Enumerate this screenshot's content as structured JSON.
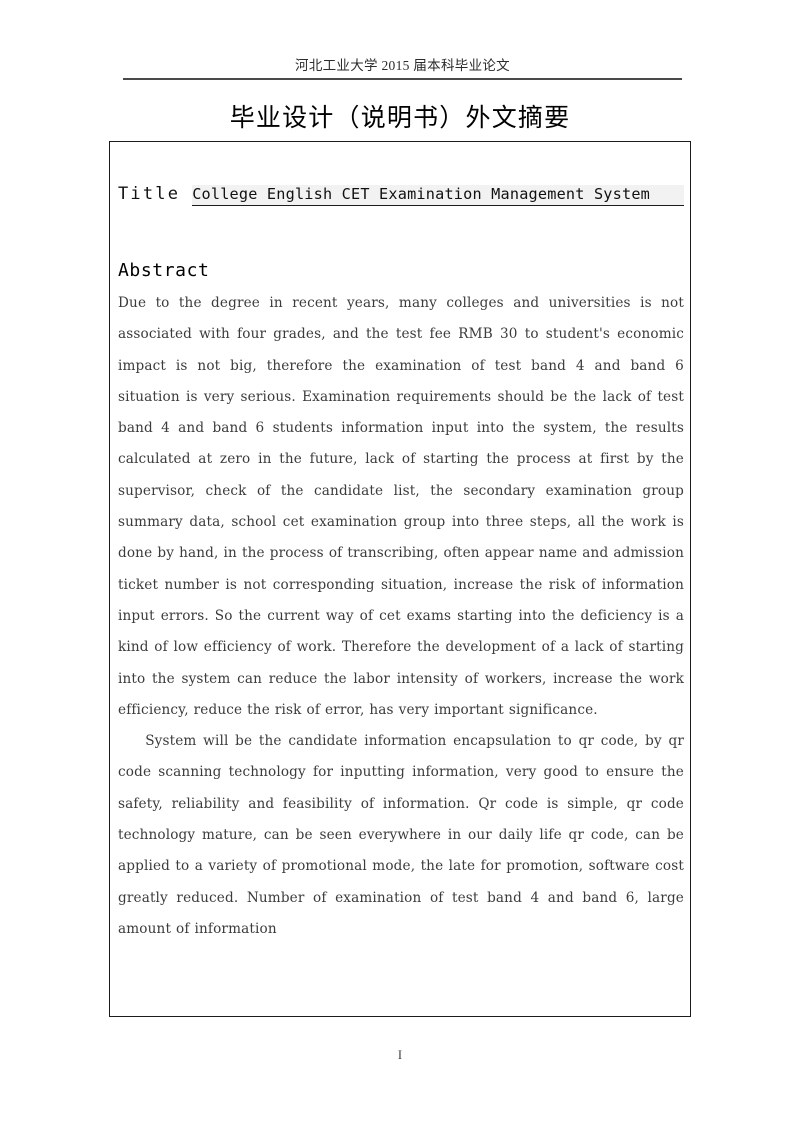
{
  "header": {
    "running_title": "河北工业大学 2015 届本科毕业论文"
  },
  "heading": {
    "text": "毕业设计（说明书）外文摘要"
  },
  "abstract_box": {
    "title_label": "Title",
    "title_value": "College English CET Examination Management System",
    "abstract_label": "Abstract",
    "paragraphs": [
      "Due to the degree in recent years, many colleges and universities is not associated with four grades, and the test fee RMB 30 to student's economic impact is not big, therefore the examination of test band 4 and band 6 situation is very serious. Examination requirements should be the lack of test band 4 and band 6 students information input into the system, the results calculated at zero in the future, lack of starting the process at first by the supervisor, check of the candidate list, the secondary examination group summary data, school cet examination group into three steps, all the work is done by hand, in the process of transcribing, often appear name and admission ticket number is not corresponding situation, increase the risk of information input errors. So the current way of cet exams starting into the deficiency is a kind of low efficiency of work. Therefore the development of a lack of starting into the system can reduce the labor intensity of workers, increase the work efficiency, reduce the risk of error, has very important significance.",
      "System will be the candidate information encapsulation to qr code, by qr code scanning technology for inputting information, very good to ensure the safety, reliability and feasibility of information. Qr code is simple, qr code technology mature, can be seen everywhere in our daily life qr code, can be applied to a variety of promotional mode, the late for promotion, software cost greatly reduced. Number of examination of test band 4 and band 6, large amount of information"
    ]
  },
  "footer": {
    "page_number": "I"
  }
}
